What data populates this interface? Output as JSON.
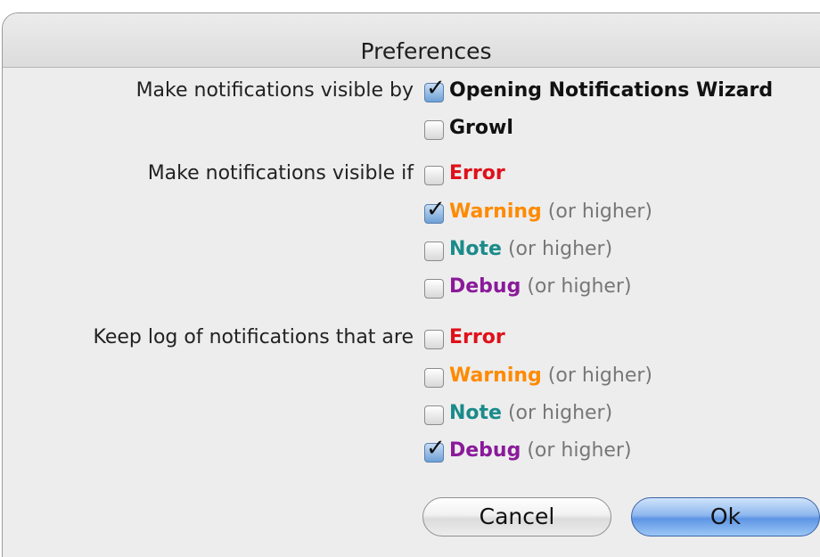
{
  "window": {
    "title": "Preferences"
  },
  "visible_by": {
    "label": "Make notifications visible by",
    "options": [
      {
        "label": "Opening Notifications Wizard",
        "checked": true
      },
      {
        "label": "Growl",
        "checked": false
      }
    ]
  },
  "visible_if": {
    "label": "Make notifications visible if",
    "options": [
      {
        "label": "Error",
        "suffix": "",
        "color": "#e0101a",
        "checked": false
      },
      {
        "label": "Warning",
        "suffix": " (or higher)",
        "color": "#ff8a00",
        "checked": true
      },
      {
        "label": "Note",
        "suffix": " (or higher)",
        "color": "#1b8a8a",
        "checked": false
      },
      {
        "label": "Debug",
        "suffix": " (or higher)",
        "color": "#8a1a9a",
        "checked": false
      }
    ]
  },
  "keep_log": {
    "label": "Keep log of notifications that are",
    "options": [
      {
        "label": "Error",
        "suffix": "",
        "color": "#e0101a",
        "checked": false
      },
      {
        "label": "Warning",
        "suffix": " (or higher)",
        "color": "#ff8a00",
        "checked": false
      },
      {
        "label": "Note",
        "suffix": " (or higher)",
        "color": "#1b8a8a",
        "checked": false
      },
      {
        "label": "Debug",
        "suffix": " (or higher)",
        "color": "#8a1a9a",
        "checked": true
      }
    ]
  },
  "buttons": {
    "cancel": "Cancel",
    "ok": "Ok"
  }
}
